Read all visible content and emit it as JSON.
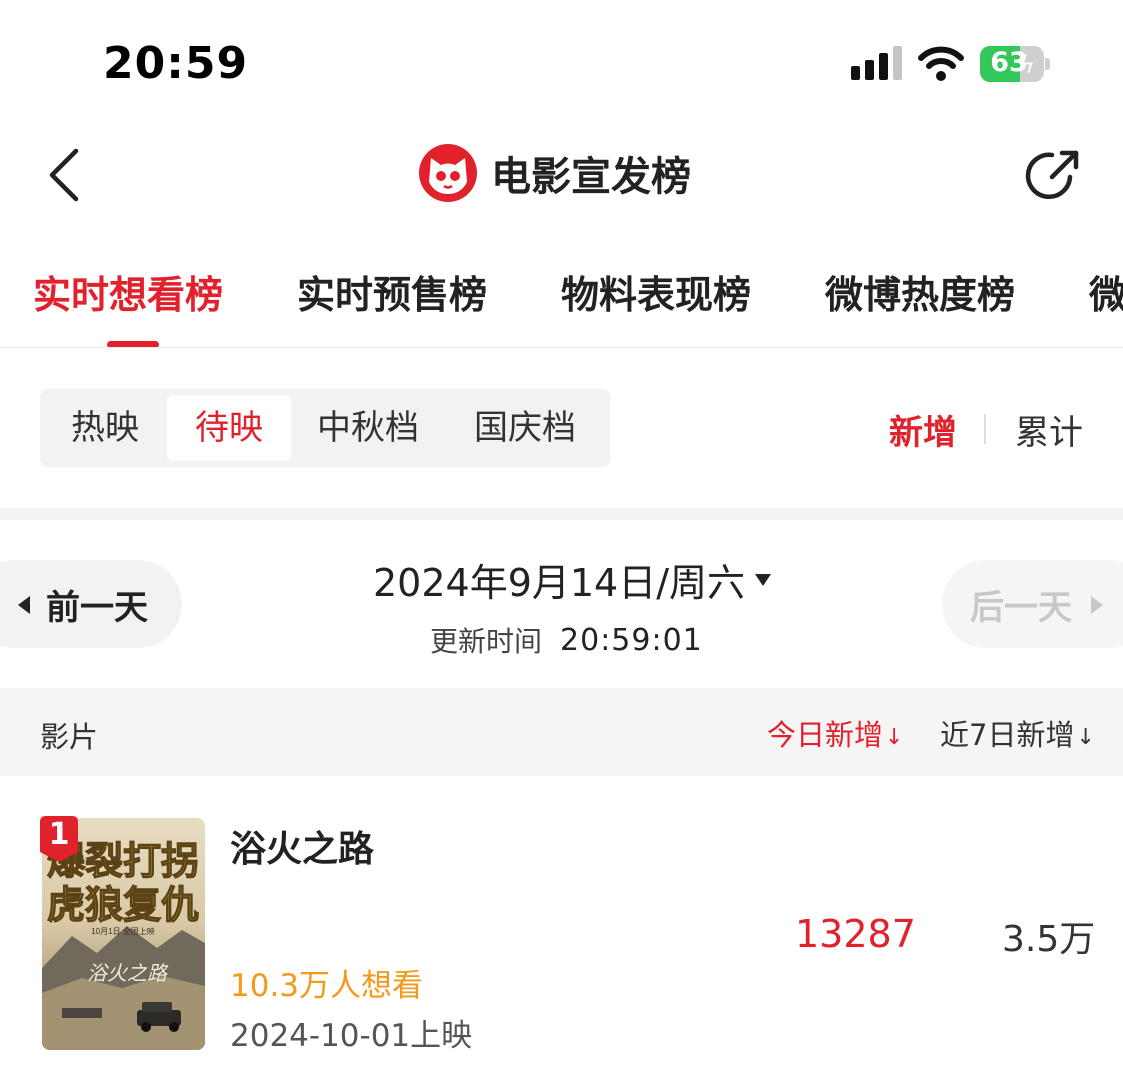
{
  "status_bar": {
    "time": "20:59",
    "battery": "63",
    "battery_level": 0.63
  },
  "nav": {
    "title": "电影宣发榜"
  },
  "main_tabs": [
    {
      "label": "实时想看榜",
      "active": true
    },
    {
      "label": "实时预售榜"
    },
    {
      "label": "物料表现榜"
    },
    {
      "label": "微博热度榜"
    },
    {
      "label": "微"
    }
  ],
  "sub_tabs": [
    {
      "label": "热映"
    },
    {
      "label": "待映",
      "active": true
    },
    {
      "label": "中秋档"
    },
    {
      "label": "国庆档"
    }
  ],
  "mode": {
    "new_label": "新增",
    "total_label": "累计"
  },
  "date_nav": {
    "prev_label": "前一天",
    "next_label": "后一天",
    "date": "2024年9月14日/周六",
    "update_label": "更新时间",
    "update_time": "20:59:01"
  },
  "table": {
    "col_movie": "影片",
    "col_today": "今日新增",
    "col_week": "近7日新增",
    "rows": [
      {
        "rank": "1",
        "title": "浴火之路",
        "want": "10.3万人想看",
        "release": "2024-10-01上映",
        "today": "13287",
        "week": "3.5万",
        "poster_text": [
          "爆裂打拐",
          "虎狼复仇",
          "10月1日 全国上映",
          "浴火之路"
        ]
      }
    ]
  },
  "colors": {
    "accent": "#e1212c",
    "want": "#f39a1a",
    "battery": "#34c759"
  }
}
